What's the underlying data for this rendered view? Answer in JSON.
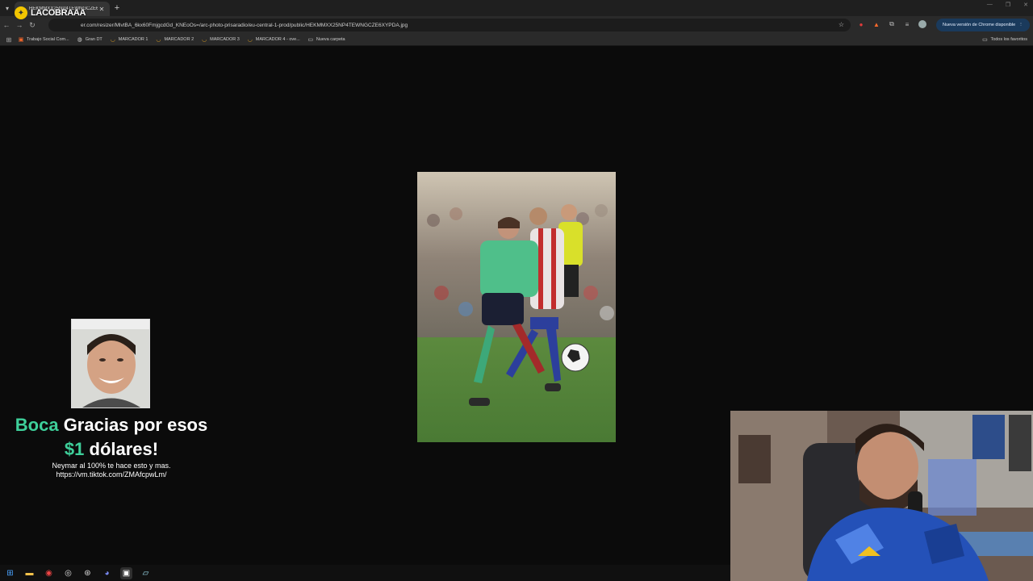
{
  "browser": {
    "tab_title": "HEKMMXX25NP4TEWNGCZE6X",
    "url": "er.com/resizer/MlvtBA_6kx60FmjgcdGd_KNEoOs=/arc-photo-prisaradio/eu-central-1-prod/public/HEKMMXX25NP4TEWNGCZE6XYPDA.jpg",
    "update_button": "Nueva versión de Chrome disponible",
    "bookmarks": [
      {
        "label": "Trabajo Social Com...",
        "icon": "trabajo-social-icon"
      },
      {
        "label": "Gran DT",
        "icon": "gran-dt-icon"
      },
      {
        "label": "MARCADOR 1",
        "icon": "marcador-icon"
      },
      {
        "label": "MARCADOR 2",
        "icon": "marcador-icon"
      },
      {
        "label": "MARCADOR 3",
        "icon": "marcador-icon"
      },
      {
        "label": "MARCADOR 4 - ove...",
        "icon": "marcador-icon"
      },
      {
        "label": "Nueva carpeta",
        "icon": "folder-icon"
      }
    ],
    "all_bookmarks": "Todos los favoritos"
  },
  "overlay": {
    "logo_text": "LACOBRAAA"
  },
  "donation": {
    "name": "Boca",
    "line1_rest": "Gracias por esos",
    "amount": "$1",
    "line2_rest": "dólares!",
    "message": "Neymar al 100% te hace esto y mas.",
    "link": "https://vm.tiktok.com/ZMAfcpwLm/"
  },
  "taskbar": {
    "icons": [
      "windows-start-icon",
      "file-explorer-icon",
      "chrome-icon",
      "obs-icon",
      "app-icon",
      "discord-icon",
      "capture-icon",
      "notes-icon"
    ]
  },
  "colors": {
    "accent": "#3ecf9a",
    "background": "#0b0b0b",
    "update_button": "#1a3a5c"
  }
}
